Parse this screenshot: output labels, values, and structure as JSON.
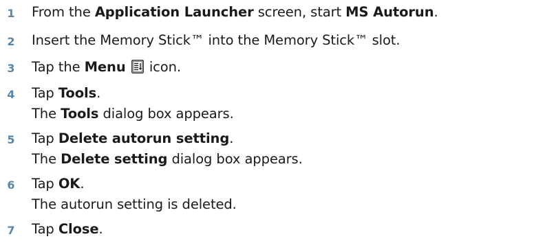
{
  "steps": [
    {
      "number": "1",
      "lines": [
        {
          "t1": "From the ",
          "b1": "Application Launcher",
          "t2": " screen, start ",
          "b2": "MS Autorun",
          "t3": "."
        }
      ]
    },
    {
      "number": "2",
      "text": "Insert the Memory Stick™ into the Memory Stick™ slot."
    },
    {
      "number": "3",
      "t1": "Tap the ",
      "b1": "Menu",
      "t2": " icon.",
      "icon": "menu-icon"
    },
    {
      "number": "4",
      "l1": {
        "t1": "Tap ",
        "b1": "Tools",
        "t2": "."
      },
      "l2": {
        "t1": "The ",
        "b1": "Tools",
        "t2": " dialog box appears."
      }
    },
    {
      "number": "5",
      "l1": {
        "t1": "Tap ",
        "b1": "Delete autorun setting",
        "t2": "."
      },
      "l2": {
        "t1": "The ",
        "b1": "Delete setting",
        "t2": " dialog box appears."
      }
    },
    {
      "number": "6",
      "l1": {
        "t1": "Tap ",
        "b1": "OK",
        "t2": "."
      },
      "l2": {
        "t1": "The autorun setting is deleted."
      }
    },
    {
      "number": "7",
      "l1": {
        "t1": "Tap ",
        "b1": "Close",
        "t2": "."
      }
    }
  ]
}
